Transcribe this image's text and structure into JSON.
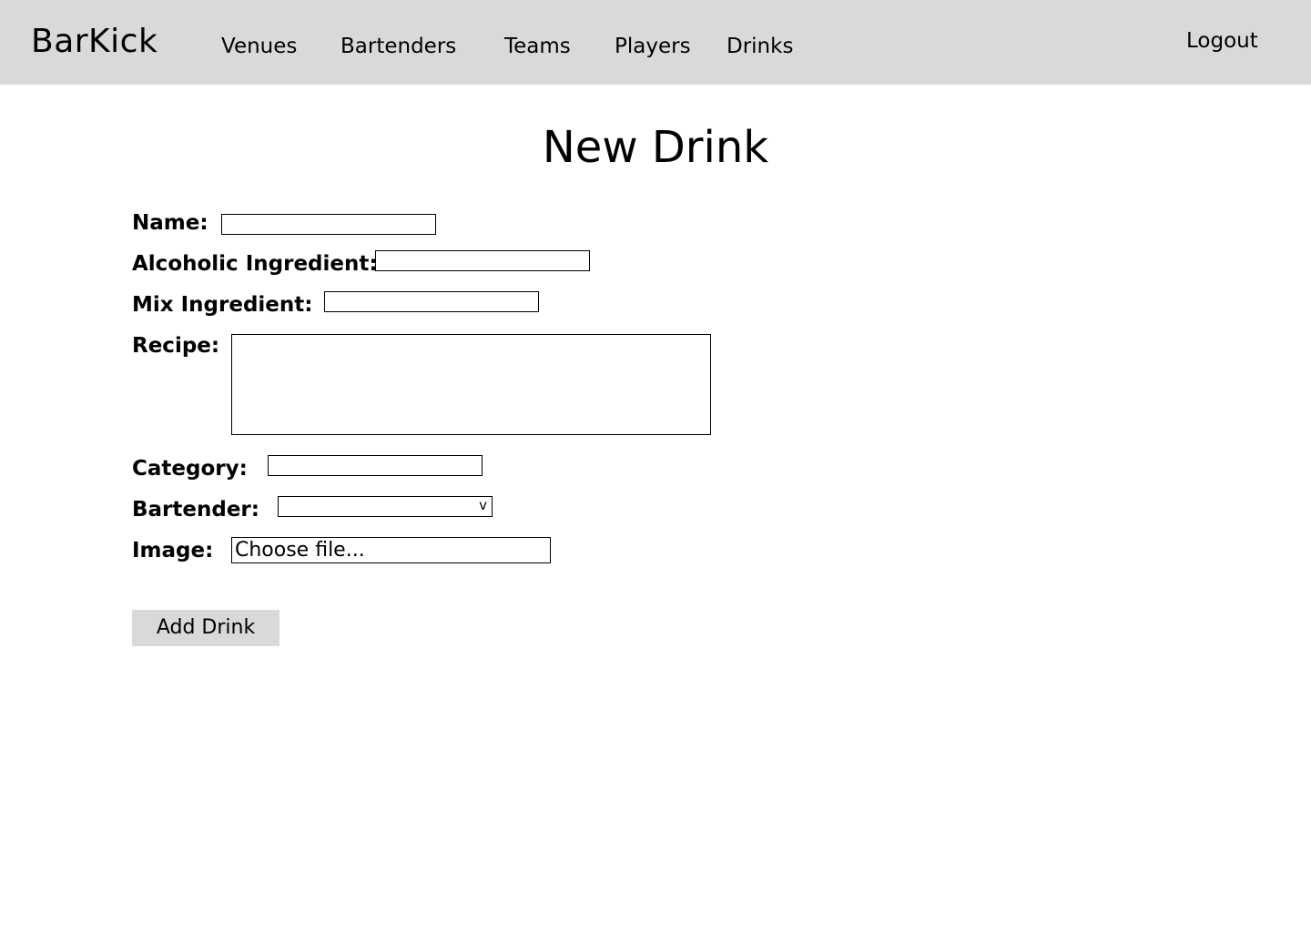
{
  "header": {
    "brand": "BarKick",
    "nav": [
      "Venues",
      "Bartenders",
      "Teams",
      "Players",
      "Drinks"
    ],
    "logout": "Logout"
  },
  "page": {
    "title": "New Drink"
  },
  "form": {
    "name_label": "Name:",
    "name_value": "",
    "alcoholic_label": "Alcoholic Ingredient:",
    "alcoholic_value": "",
    "mix_label": "Mix Ingredient:",
    "mix_value": "",
    "recipe_label": "Recipe:",
    "recipe_value": "",
    "category_label": "Category:",
    "category_value": "",
    "bartender_label": "Bartender:",
    "bartender_selected": "",
    "bartender_chevron": "v",
    "image_label": "Image:",
    "image_button": "Choose file...",
    "submit_label": "Add Drink"
  }
}
